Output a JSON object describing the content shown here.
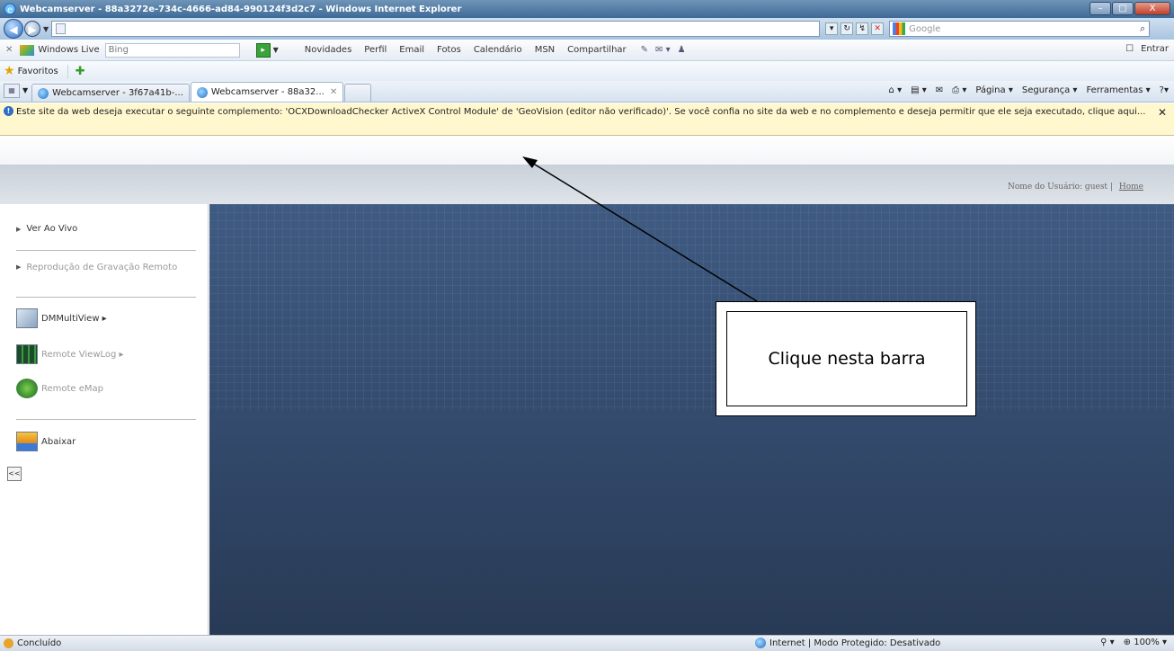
{
  "window": {
    "title": "Webcamserver - 88a3272e-734c-4666-ad84-990124f3d2c7 - Windows Internet Explorer",
    "buttons": {
      "minimize": "–",
      "maximize": "□",
      "close": "X"
    }
  },
  "addressbar": {
    "nav_back": "◀",
    "nav_forward": "▶",
    "search_placeholder": "Google",
    "search_icon": "⌕"
  },
  "livebar": {
    "close": "✕",
    "brand": "Windows Live",
    "search_value": "Bing",
    "links": [
      "Novidades",
      "Perfil",
      "Email",
      "Fotos",
      "Calendário",
      "MSN",
      "Compartilhar"
    ],
    "signin": "Entrar"
  },
  "favorites": {
    "label": "Favoritos"
  },
  "tabs": [
    {
      "label": "Webcamserver - 3f67a41b-..."
    },
    {
      "label": "Webcamserver - 88a32...",
      "close": "✕"
    }
  ],
  "commandbar": {
    "items": [
      "Página ▾",
      "Segurança ▾",
      "Ferramentas ▾"
    ],
    "help": "?▾"
  },
  "infobar": {
    "text": "Este site da web deseja executar o seguinte complemento: 'OCXDownloadChecker ActiveX Control Module' de 'GeoVision (editor não verificado)'. Se você confia no site da web e no complemento e deseja permitir que ele seja executado, clique aqui...",
    "close": "✕"
  },
  "header": {
    "user_label": "Nome do Usuário: guest",
    "separator": "|",
    "home_link": "Home"
  },
  "sidebar": {
    "live": "Ver Ao Vivo",
    "playback": "Reprodução de Gravação Remoto",
    "multiview": "DMMultiView ▸",
    "viewlog": "Remote ViewLog ▸",
    "emap": "Remote eMap",
    "download": "Abaixar",
    "collapse": "<<"
  },
  "annotation": {
    "text": "Clique nesta barra"
  },
  "statusbar": {
    "status": "Concluído",
    "zone": "Internet | Modo Protegido: Desativado",
    "zoom": "100%"
  },
  "colors": {
    "infobar_bg": "#fff8cf",
    "main_bg": "#35506f",
    "title_bg": "#3d6a96"
  }
}
